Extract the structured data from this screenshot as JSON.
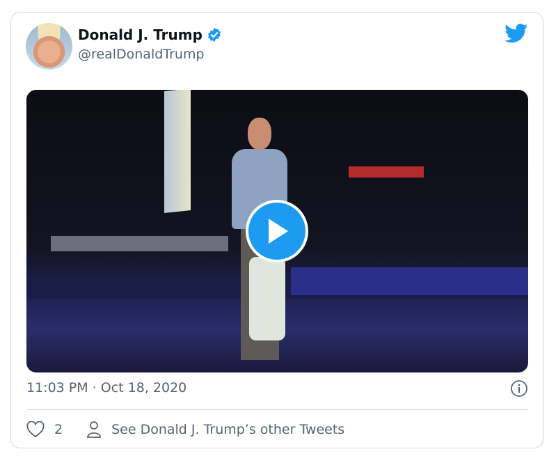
{
  "author": {
    "name": "Donald J. Trump",
    "handle": "@realDonaldTrump",
    "verified": true
  },
  "tweet": {
    "timestamp": "11:03 PM · Oct 18, 2020",
    "likes": "2",
    "other_tweets_label": "See Donald J. Trump’s other Tweets"
  },
  "colors": {
    "accent": "#1d9bf0",
    "text_secondary": "#536471",
    "border": "#cfd9de"
  }
}
